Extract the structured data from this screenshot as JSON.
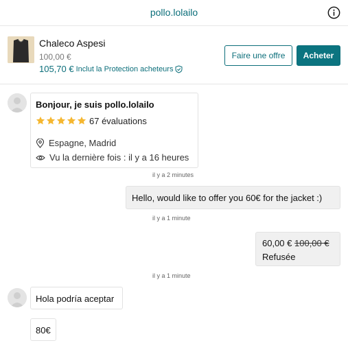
{
  "header": {
    "title": "pollo.lolailo",
    "info_icon": "info-icon"
  },
  "item": {
    "title": "Chaleco Aspesi",
    "original_price": "100,00 €",
    "price": "105,70 €",
    "protection_label": "Inclut la Protection acheteurs",
    "offer_button": "Faire une offre",
    "buy_button": "Acheter",
    "accent_color": "#0b6e7a"
  },
  "profile_card": {
    "greeting": "Bonjour, je suis pollo.lolailo",
    "rating_stars": 5,
    "reviews": "67 évaluations",
    "location": "Espagne, Madrid",
    "last_seen": "Vu la dernière fois : il y a 16 heures",
    "timestamp": "il y a 2 minutes"
  },
  "messages": [
    {
      "side": "right",
      "text": "Hello, would like to offer you 60€ for the jacket :)",
      "timestamp": "il y a 1 minute"
    },
    {
      "side": "right",
      "type": "offer",
      "offer_price": "60,00 €",
      "original_price": "100,00 €",
      "status": "Refusée",
      "timestamp": "il y a 1 minute"
    },
    {
      "side": "left",
      "text": "Hola podría aceptar"
    },
    {
      "side": "left",
      "text": "80€"
    }
  ]
}
